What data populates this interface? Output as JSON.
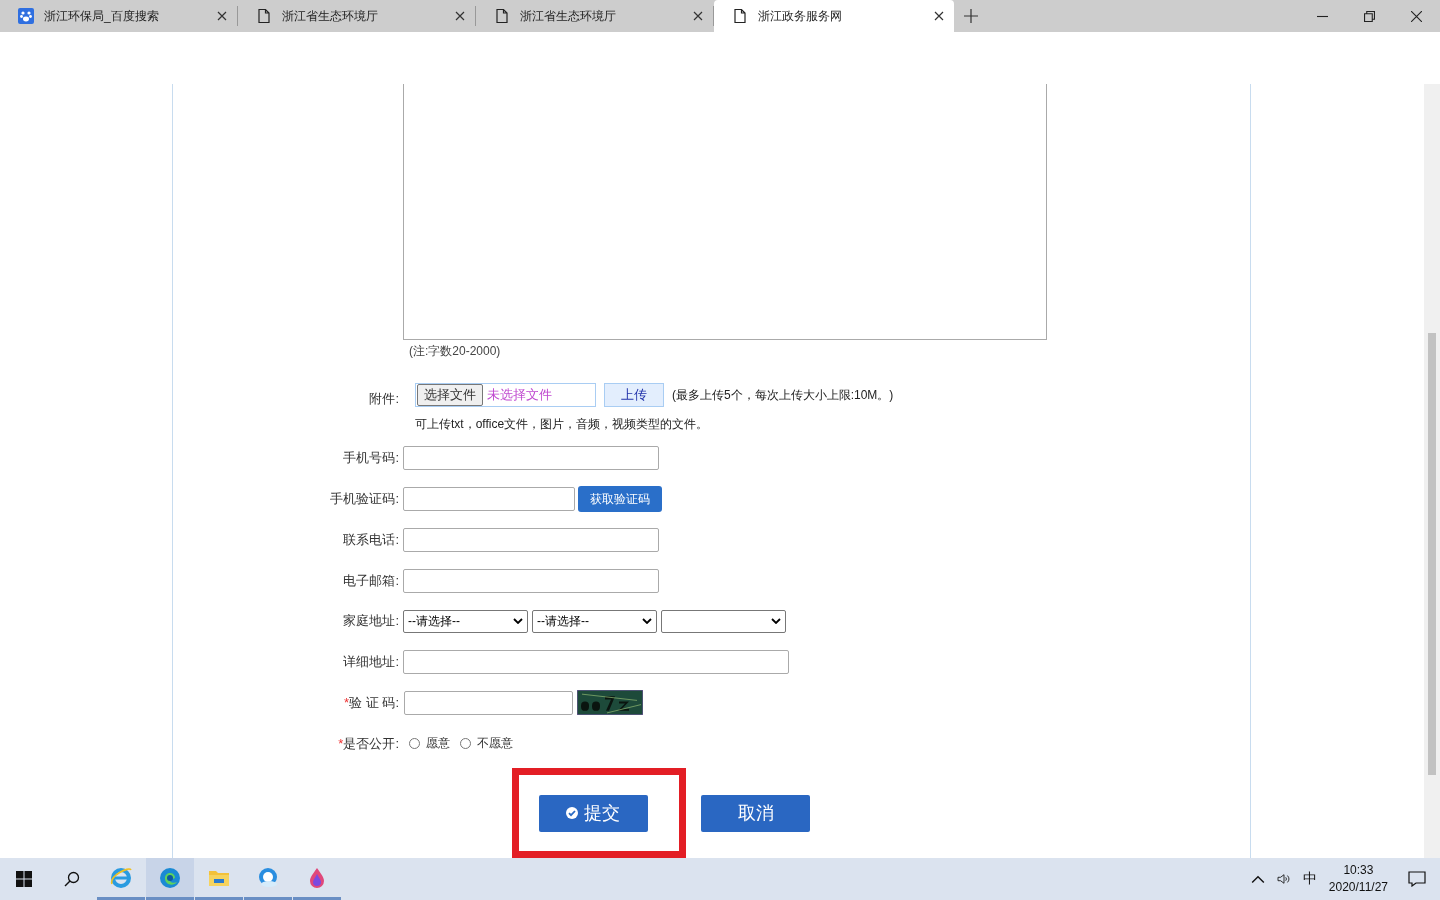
{
  "tabs": [
    {
      "title": "浙江环保局_百度搜索",
      "kind": "paw",
      "selected": false
    },
    {
      "title": "浙江省生态环境厅",
      "kind": "page",
      "selected": false
    },
    {
      "title": "浙江省生态环境厅",
      "kind": "page",
      "selected": false
    },
    {
      "title": "浙江政务服务网",
      "kind": "page",
      "selected": true
    }
  ],
  "form": {
    "content_note": "(注:字数20-2000)",
    "attachment": {
      "label": "附件:",
      "choose_button": "选择文件",
      "no_file": "未选择文件",
      "upload_button": "上传",
      "limit_note": "(最多上传5个，每次上传大小上限:10M。)",
      "types_note": "可上传txt，office文件，图片，音频，视频类型的文件。"
    },
    "rows": [
      {
        "kind": "input",
        "label": "手机号码:"
      },
      {
        "kind": "input_button",
        "label": "手机验证码:",
        "button": "获取验证码"
      },
      {
        "kind": "input",
        "label": "联系电话:"
      },
      {
        "kind": "input",
        "label": "电子邮箱:"
      },
      {
        "kind": "selects",
        "label": "家庭地址:",
        "selects": [
          {
            "kind": "choice",
            "value": "--请选择--"
          },
          {
            "kind": "choice",
            "value": "--请选择--"
          },
          {
            "kind": "blank"
          }
        ]
      },
      {
        "kind": "wide_input",
        "label": "详细地址:"
      },
      {
        "kind": "captcha",
        "label": "验 证 码:",
        "required_mark": "*"
      },
      {
        "kind": "radios",
        "label": "是否公开:",
        "required_mark": "*",
        "options": [
          {
            "label": "愿意",
            "checked": false
          },
          {
            "label": "不愿意",
            "checked": false
          }
        ]
      }
    ],
    "submit": "提交",
    "cancel": "取消"
  },
  "taskbar": {
    "time": "10:33",
    "date": "2020/11/27",
    "ime": "中"
  }
}
